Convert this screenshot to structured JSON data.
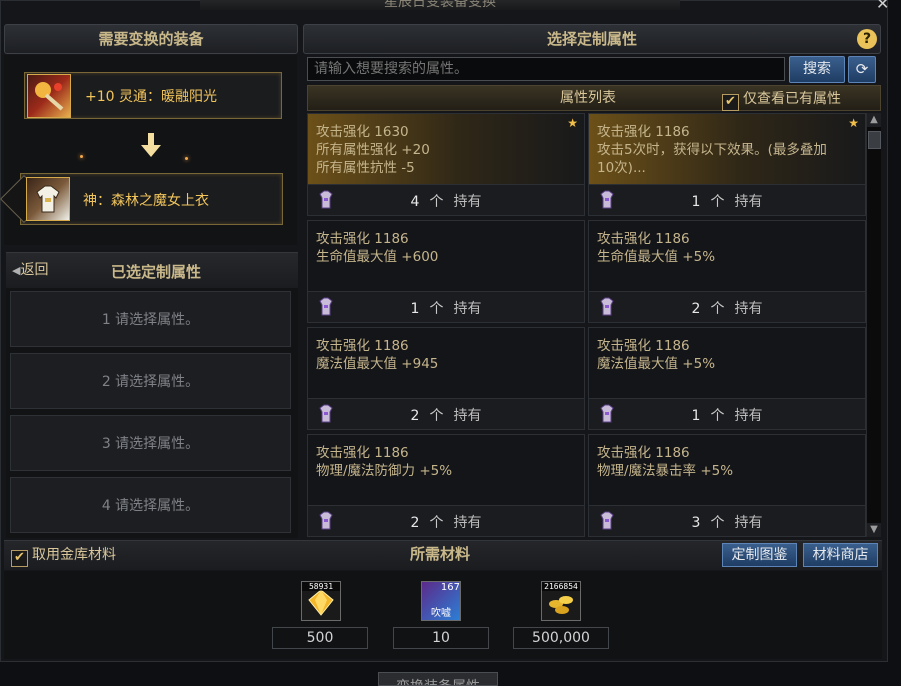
{
  "window": {
    "title": "星辰日变装备变换",
    "bottom_label": "变换装备属性"
  },
  "left": {
    "header": "需要变换的装备",
    "source_item": {
      "name": "+10 灵通：暖融阳光",
      "icon": "warm-sun-accessory-icon"
    },
    "target_item": {
      "name": "神：森林之魔女上衣",
      "icon": "forest-witch-top-icon"
    },
    "back_label": "返回",
    "selected_header": "已选定制属性",
    "slots": [
      "1 请选择属性。",
      "2 请选择属性。",
      "3 请选择属性。",
      "4 请选择属性。"
    ]
  },
  "right": {
    "header": "选择定制属性",
    "search_placeholder": "请输入想要搜索的属性。",
    "search_button": "搜索",
    "list_title": "属性列表",
    "owned_filter": "仅查看已有属性",
    "owned_filter_checked": true,
    "owned_label": "持有",
    "unit": "个",
    "cards": [
      {
        "lines": [
          "攻击强化 1630",
          "所有属性强化 +20",
          "所有属性抗性 -5"
        ],
        "count": "4",
        "starred": true,
        "highlight": true
      },
      {
        "lines": [
          "攻击强化 1186",
          "攻击5次时，获得以下效果。(最多叠加",
          "10次)..."
        ],
        "count": "1",
        "starred": true,
        "highlight": true
      },
      {
        "lines": [
          "攻击强化 1186",
          "生命值最大值 +600"
        ],
        "count": "1",
        "starred": false,
        "highlight": false
      },
      {
        "lines": [
          "攻击强化 1186",
          "生命值最大值 +5%"
        ],
        "count": "2",
        "starred": false,
        "highlight": false
      },
      {
        "lines": [
          "攻击强化 1186",
          "魔法值最大值 +945"
        ],
        "count": "2",
        "starred": false,
        "highlight": false
      },
      {
        "lines": [
          "攻击强化 1186",
          "魔法值最大值 +5%"
        ],
        "count": "1",
        "starred": false,
        "highlight": false
      },
      {
        "lines": [
          "攻击强化 1186",
          "物理/魔法防御力 +5%"
        ],
        "count": "2",
        "starred": false,
        "highlight": false
      },
      {
        "lines": [
          "攻击强化 1186",
          "物理/魔法暴击率 +5%"
        ],
        "count": "3",
        "starred": false,
        "highlight": false
      }
    ]
  },
  "bottom": {
    "use_gold_storage": "取用金库材料",
    "use_gold_storage_checked": true,
    "materials_title": "所需材料",
    "catalog_button": "定制图鉴",
    "shop_button": "材料商店",
    "materials": [
      {
        "icon": "gold-crystal-icon",
        "owned": "58931",
        "required": "500"
      },
      {
        "icon": "ticket-card-icon",
        "owned": "167",
        "tag": "吹嘘",
        "required": "10"
      },
      {
        "icon": "gold-coins-icon",
        "owned": "2166854",
        "required": "500,000"
      }
    ]
  },
  "colors": {
    "accent_gold": "#f2c55c",
    "button_blue": "#2b4d7a",
    "panel_bg": "#141619"
  }
}
